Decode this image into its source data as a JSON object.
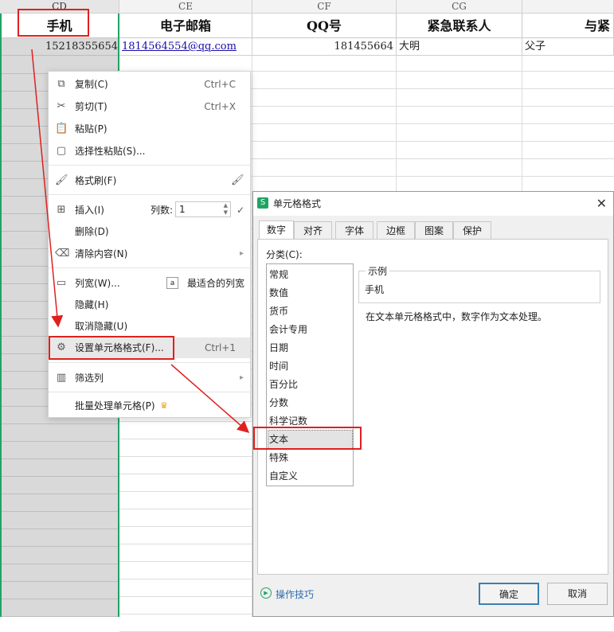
{
  "columns": [
    {
      "letter": "CD",
      "header": "手机"
    },
    {
      "letter": "CE",
      "header": "电子邮箱"
    },
    {
      "letter": "CF",
      "header": "QQ号"
    },
    {
      "letter": "CG",
      "header": "紧急联系人"
    },
    {
      "letter": "",
      "header": "与紧"
    }
  ],
  "row1": {
    "phone": "15218355654",
    "email": "1814564554@qq.com",
    "qq": "181455664",
    "contact": "大明",
    "relation": "父子"
  },
  "menu": {
    "copy": {
      "label": "复制(C)",
      "shortcut": "Ctrl+C"
    },
    "cut": {
      "label": "剪切(T)",
      "shortcut": "Ctrl+X"
    },
    "paste": {
      "label": "粘贴(P)"
    },
    "paste_special": {
      "label": "选择性粘贴(S)..."
    },
    "format_painter": {
      "label": "格式刷(F)"
    },
    "insert": {
      "label": "插入(I)",
      "count_label": "列数:",
      "count_value": "1"
    },
    "delete": {
      "label": "删除(D)"
    },
    "clear": {
      "label": "清除内容(N)"
    },
    "col_width": {
      "label": "列宽(W)...",
      "best_fit": "最适合的列宽"
    },
    "hide": {
      "label": "隐藏(H)"
    },
    "unhide": {
      "label": "取消隐藏(U)"
    },
    "format_cells": {
      "label": "设置单元格格式(F)...",
      "shortcut": "Ctrl+1"
    },
    "filter_col": {
      "label": "筛选列"
    },
    "batch": {
      "label": "批量处理单元格(P)"
    }
  },
  "dialog": {
    "title": "单元格格式",
    "tabs": [
      "数字",
      "对齐",
      "字体",
      "边框",
      "图案",
      "保护"
    ],
    "category_label": "分类(C):",
    "categories": [
      "常规",
      "数值",
      "货币",
      "会计专用",
      "日期",
      "时间",
      "百分比",
      "分数",
      "科学记数",
      "文本",
      "特殊",
      "自定义"
    ],
    "selected_category": "文本",
    "sample_label": "示例",
    "sample_value": "手机",
    "description": "在文本单元格格式中，数字作为文本处理。",
    "tips_link": "操作技巧",
    "ok": "确定",
    "cancel": "取消"
  },
  "colors": {
    "accent": "#21a366",
    "highlight_red": "#e02020",
    "link": "#1a0dab"
  }
}
